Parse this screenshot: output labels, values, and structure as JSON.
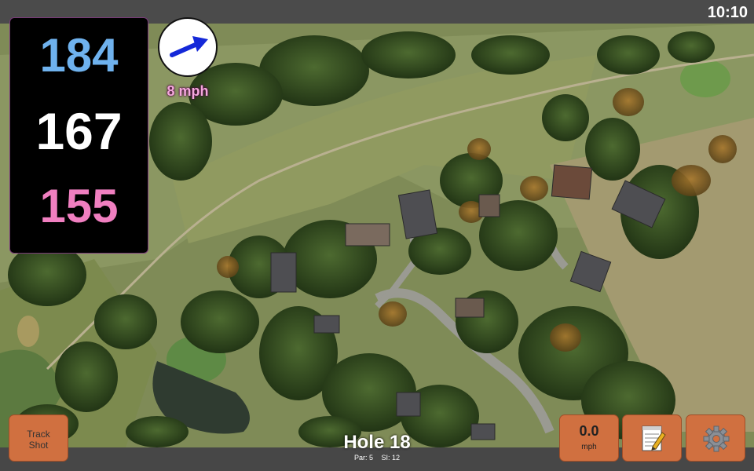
{
  "status_bar": {
    "time": "10:10"
  },
  "yardage": {
    "back": "184",
    "center": "167",
    "front": "155"
  },
  "wind": {
    "speed_label": "8 mph",
    "icon": "wind-arrow-icon"
  },
  "hole": {
    "title": "Hole 18",
    "par": "Par: 5",
    "stroke_index": "SI: 12"
  },
  "buttons": {
    "track_shot": "Track Shot",
    "speed_value": "0.0",
    "speed_unit": "mph",
    "notes_icon": "notepad-icon",
    "settings_icon": "gear-icon"
  },
  "colors": {
    "back_yardage": "#6fb2ee",
    "center_yardage": "#ffffff",
    "front_yardage": "#f07fc0",
    "button": "#d07040",
    "wind_arrow": "#1428d8"
  }
}
